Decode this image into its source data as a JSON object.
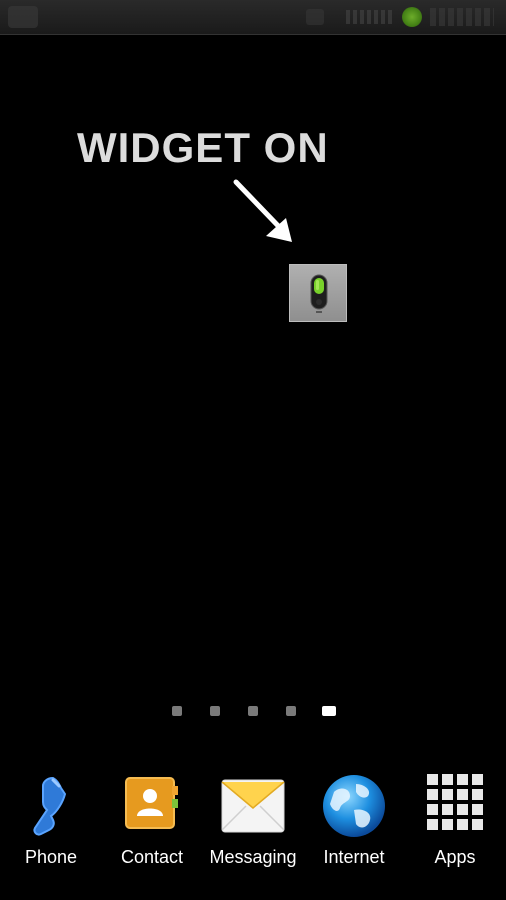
{
  "annotation": {
    "title": "WIDGET ON"
  },
  "widget": {
    "icon": "toggle-switch-icon",
    "state": "on",
    "accent_color": "#78d12a"
  },
  "page_indicator": {
    "count": 5,
    "active_index": 4
  },
  "dock": {
    "items": [
      {
        "label": "Phone",
        "icon": "phone-icon"
      },
      {
        "label": "Contact",
        "icon": "contact-icon"
      },
      {
        "label": "Messaging",
        "icon": "messaging-icon"
      },
      {
        "label": "Internet",
        "icon": "internet-globe-icon"
      },
      {
        "label": "Apps",
        "icon": "apps-grid-icon"
      }
    ]
  },
  "colors": {
    "background": "#000000",
    "text": "#ffffff",
    "annotation_text": "#dcdcdc"
  }
}
